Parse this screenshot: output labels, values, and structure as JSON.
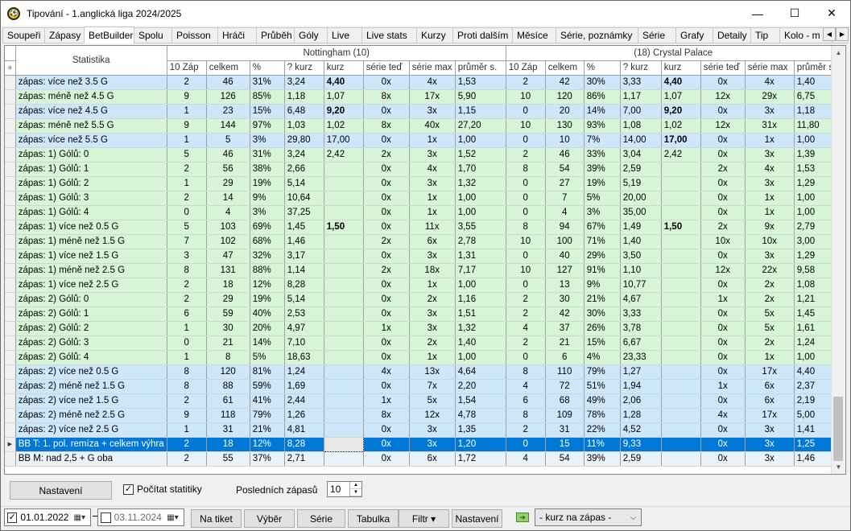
{
  "window": {
    "title": "Tipování - 1.anglická liga 2024/2025",
    "minimize": "—",
    "maximize": "☐",
    "close": "✕"
  },
  "tabs": [
    "Soupeři",
    "Zápasy",
    "BetBuilder",
    "Spolu",
    "Poisson",
    "Hráči",
    "Průběh",
    "Góly",
    "Live",
    "Live stats",
    "Kurzy",
    "Proti dalším",
    "Měsíce",
    "Série, poznámky",
    "Série",
    "Grafy",
    "Detaily",
    "Tip",
    "Kolo - m"
  ],
  "active_tab": "BetBuilder",
  "grid": {
    "header_stat": "Statistika",
    "team1": "Nottingham (10)",
    "team2": "(18) Crystal Palace",
    "columns": [
      "10 Záp",
      "celkem",
      "%",
      "? kurz",
      "kurz",
      "série teď",
      "série max",
      "průměr s."
    ],
    "rows": [
      {
        "s": "zápas: více než 3.5 G",
        "c": "blue",
        "a": [
          "2",
          "46",
          "31%",
          "3,24",
          "4,40",
          "0x",
          "4x",
          "1,53"
        ],
        "b": [
          "2",
          "42",
          "30%",
          "3,33",
          "4,40",
          "0x",
          "4x",
          "1,40"
        ],
        "bold": true
      },
      {
        "s": "zápas: méně než 4.5 G",
        "c": "green",
        "a": [
          "9",
          "126",
          "85%",
          "1,18",
          "1,07",
          "8x",
          "17x",
          "5,90"
        ],
        "b": [
          "10",
          "120",
          "86%",
          "1,17",
          "1,07",
          "12x",
          "29x",
          "6,75"
        ]
      },
      {
        "s": "zápas: více než 4.5 G",
        "c": "blue",
        "a": [
          "1",
          "23",
          "15%",
          "6,48",
          "9,20",
          "0x",
          "3x",
          "1,15"
        ],
        "b": [
          "0",
          "20",
          "14%",
          "7,00",
          "9,20",
          "0x",
          "3x",
          "1,18"
        ],
        "bold": true
      },
      {
        "s": "zápas: méně než 5.5 G",
        "c": "green",
        "a": [
          "9",
          "144",
          "97%",
          "1,03",
          "1,02",
          "8x",
          "40x",
          "27,20"
        ],
        "b": [
          "10",
          "130",
          "93%",
          "1,08",
          "1,02",
          "12x",
          "31x",
          "11,80"
        ]
      },
      {
        "s": "zápas: více než 5.5 G",
        "c": "blue",
        "a": [
          "1",
          "5",
          "3%",
          "29,80",
          "17,00",
          "0x",
          "1x",
          "1,00"
        ],
        "b": [
          "0",
          "10",
          "7%",
          "14,00",
          "17,00",
          "0x",
          "1x",
          "1,00"
        ],
        "boldb": true
      },
      {
        "s": "zápas: 1) Gólů: 0",
        "c": "green",
        "a": [
          "5",
          "46",
          "31%",
          "3,24",
          "2,42",
          "2x",
          "3x",
          "1,52"
        ],
        "b": [
          "2",
          "46",
          "33%",
          "3,04",
          "2,42",
          "0x",
          "3x",
          "1,39"
        ]
      },
      {
        "s": "zápas: 1) Gólů: 1",
        "c": "green",
        "a": [
          "2",
          "56",
          "38%",
          "2,66",
          "",
          "0x",
          "4x",
          "1,70"
        ],
        "b": [
          "8",
          "54",
          "39%",
          "2,59",
          "",
          "2x",
          "4x",
          "1,53"
        ]
      },
      {
        "s": "zápas: 1) Gólů: 2",
        "c": "green",
        "a": [
          "1",
          "29",
          "19%",
          "5,14",
          "",
          "0x",
          "3x",
          "1,32"
        ],
        "b": [
          "0",
          "27",
          "19%",
          "5,19",
          "",
          "0x",
          "3x",
          "1,29"
        ]
      },
      {
        "s": "zápas: 1) Gólů: 3",
        "c": "green",
        "a": [
          "2",
          "14",
          "9%",
          "10,64",
          "",
          "0x",
          "1x",
          "1,00"
        ],
        "b": [
          "0",
          "7",
          "5%",
          "20,00",
          "",
          "0x",
          "1x",
          "1,00"
        ]
      },
      {
        "s": "zápas: 1) Gólů: 4",
        "c": "green",
        "a": [
          "0",
          "4",
          "3%",
          "37,25",
          "",
          "0x",
          "1x",
          "1,00"
        ],
        "b": [
          "0",
          "4",
          "3%",
          "35,00",
          "",
          "0x",
          "1x",
          "1,00"
        ]
      },
      {
        "s": "zápas: 1) více než 0.5 G",
        "c": "green",
        "a": [
          "5",
          "103",
          "69%",
          "1,45",
          "1,50",
          "0x",
          "11x",
          "3,55"
        ],
        "b": [
          "8",
          "94",
          "67%",
          "1,49",
          "1,50",
          "2x",
          "9x",
          "2,79"
        ],
        "bold": true
      },
      {
        "s": "zápas: 1) méně než 1.5 G",
        "c": "green",
        "a": [
          "7",
          "102",
          "68%",
          "1,46",
          "",
          "2x",
          "6x",
          "2,78"
        ],
        "b": [
          "10",
          "100",
          "71%",
          "1,40",
          "",
          "10x",
          "10x",
          "3,00"
        ]
      },
      {
        "s": "zápas: 1) více než 1.5 G",
        "c": "green",
        "a": [
          "3",
          "47",
          "32%",
          "3,17",
          "",
          "0x",
          "3x",
          "1,31"
        ],
        "b": [
          "0",
          "40",
          "29%",
          "3,50",
          "",
          "0x",
          "3x",
          "1,29"
        ]
      },
      {
        "s": "zápas: 1) méně než 2.5 G",
        "c": "green",
        "a": [
          "8",
          "131",
          "88%",
          "1,14",
          "",
          "2x",
          "18x",
          "7,17"
        ],
        "b": [
          "10",
          "127",
          "91%",
          "1,10",
          "",
          "12x",
          "22x",
          "9,58"
        ]
      },
      {
        "s": "zápas: 1) více než 2.5 G",
        "c": "green",
        "a": [
          "2",
          "18",
          "12%",
          "8,28",
          "",
          "0x",
          "1x",
          "1,00"
        ],
        "b": [
          "0",
          "13",
          "9%",
          "10,77",
          "",
          "0x",
          "2x",
          "1,08"
        ]
      },
      {
        "s": "zápas: 2) Gólů: 0",
        "c": "green",
        "a": [
          "2",
          "29",
          "19%",
          "5,14",
          "",
          "0x",
          "2x",
          "1,16"
        ],
        "b": [
          "2",
          "30",
          "21%",
          "4,67",
          "",
          "1x",
          "2x",
          "1,21"
        ]
      },
      {
        "s": "zápas: 2) Gólů: 1",
        "c": "green",
        "a": [
          "6",
          "59",
          "40%",
          "2,53",
          "",
          "0x",
          "3x",
          "1,51"
        ],
        "b": [
          "2",
          "42",
          "30%",
          "3,33",
          "",
          "0x",
          "5x",
          "1,45"
        ]
      },
      {
        "s": "zápas: 2) Gólů: 2",
        "c": "green",
        "a": [
          "1",
          "30",
          "20%",
          "4,97",
          "",
          "1x",
          "3x",
          "1,32"
        ],
        "b": [
          "4",
          "37",
          "26%",
          "3,78",
          "",
          "0x",
          "5x",
          "1,61"
        ]
      },
      {
        "s": "zápas: 2) Gólů: 3",
        "c": "green",
        "a": [
          "0",
          "21",
          "14%",
          "7,10",
          "",
          "0x",
          "2x",
          "1,40"
        ],
        "b": [
          "2",
          "21",
          "15%",
          "6,67",
          "",
          "0x",
          "2x",
          "1,24"
        ]
      },
      {
        "s": "zápas: 2) Gólů: 4",
        "c": "green",
        "a": [
          "1",
          "8",
          "5%",
          "18,63",
          "",
          "0x",
          "1x",
          "1,00"
        ],
        "b": [
          "0",
          "6",
          "4%",
          "23,33",
          "",
          "0x",
          "1x",
          "1,00"
        ]
      },
      {
        "s": "zápas: 2) více než 0.5 G",
        "c": "blue",
        "a": [
          "8",
          "120",
          "81%",
          "1,24",
          "",
          "4x",
          "13x",
          "4,64"
        ],
        "b": [
          "8",
          "110",
          "79%",
          "1,27",
          "",
          "0x",
          "17x",
          "4,40"
        ]
      },
      {
        "s": "zápas: 2) méně než 1.5 G",
        "c": "blue",
        "a": [
          "8",
          "88",
          "59%",
          "1,69",
          "",
          "0x",
          "7x",
          "2,20"
        ],
        "b": [
          "4",
          "72",
          "51%",
          "1,94",
          "",
          "1x",
          "6x",
          "2,37"
        ]
      },
      {
        "s": "zápas: 2) více než 1.5 G",
        "c": "blue",
        "a": [
          "2",
          "61",
          "41%",
          "2,44",
          "",
          "1x",
          "5x",
          "1,54"
        ],
        "b": [
          "6",
          "68",
          "49%",
          "2,06",
          "",
          "0x",
          "6x",
          "2,19"
        ]
      },
      {
        "s": "zápas: 2) méně než 2.5 G",
        "c": "blue",
        "a": [
          "9",
          "118",
          "79%",
          "1,26",
          "",
          "8x",
          "12x",
          "4,78"
        ],
        "b": [
          "8",
          "109",
          "78%",
          "1,28",
          "",
          "4x",
          "17x",
          "5,00"
        ]
      },
      {
        "s": "zápas: 2) více než 2.5 G",
        "c": "blue",
        "a": [
          "1",
          "31",
          "21%",
          "4,81",
          "",
          "0x",
          "3x",
          "1,35"
        ],
        "b": [
          "2",
          "31",
          "22%",
          "4,52",
          "",
          "0x",
          "3x",
          "1,41"
        ]
      },
      {
        "s": "BB T: 1. pol. remíza + celkem výhra",
        "c": "sel",
        "a": [
          "2",
          "18",
          "12%",
          "8,28",
          "",
          "0x",
          "3x",
          "1,20"
        ],
        "b": [
          "0",
          "15",
          "11%",
          "9,33",
          "",
          "0x",
          "3x",
          "1,25"
        ]
      },
      {
        "s": "BB M: nad 2,5 + G oba",
        "c": "plain",
        "a": [
          "2",
          "55",
          "37%",
          "2,71",
          "",
          "0x",
          "6x",
          "1,72"
        ],
        "b": [
          "4",
          "54",
          "39%",
          "2,59",
          "",
          "0x",
          "3x",
          "1,46"
        ]
      }
    ]
  },
  "options": {
    "nastaveni": "Nastavení",
    "pocitat": "Počítat statitiky",
    "poslednich": "Posledních zápasů",
    "pocet": "10"
  },
  "bottom": {
    "date_from": "01.01.2022",
    "date_to": "03.11.2024",
    "na_tiket": "Na tiket",
    "vyber": "Výběr",
    "serie": "Série",
    "tabulka": "Tabulka",
    "filtr": "Filtr ▾",
    "nastaveni": "Nastavení",
    "combo": "- kurz na zápas -"
  }
}
